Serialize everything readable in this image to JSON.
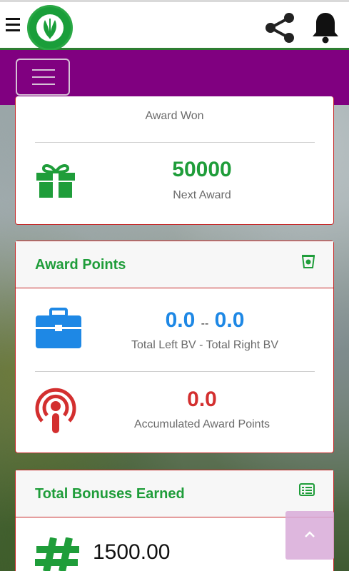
{
  "award_card": {
    "won_label": "Award Won",
    "next_value": "50000",
    "next_label": "Next Award"
  },
  "award_points": {
    "title": "Award Points",
    "left_bv": "0.0",
    "separator": "--",
    "right_bv": "0.0",
    "bv_label": "Total Left BV - Total Right BV",
    "accumulated_value": "0.0",
    "accumulated_label": "Accumulated Award Points"
  },
  "bonuses": {
    "title": "Total Bonuses Earned",
    "value": "1500.00"
  },
  "colors": {
    "brand_purple": "#800080",
    "green": "#1f9d3a",
    "blue": "#1e88e5",
    "red": "#d32f2f",
    "card_border": "#c62828"
  },
  "icons": {
    "menu": "hamburger-icon",
    "logo": "natures-renaissance-logo",
    "share": "share-icon",
    "notifications": "bell-icon",
    "gift": "gift-icon",
    "award_points_header": "cup-icon",
    "briefcase": "briefcase-icon",
    "podcast": "podcast-icon",
    "bonuses_header": "list-alt-icon",
    "hashtag": "hashtag-icon",
    "scroll_top": "chevron-up-icon"
  }
}
